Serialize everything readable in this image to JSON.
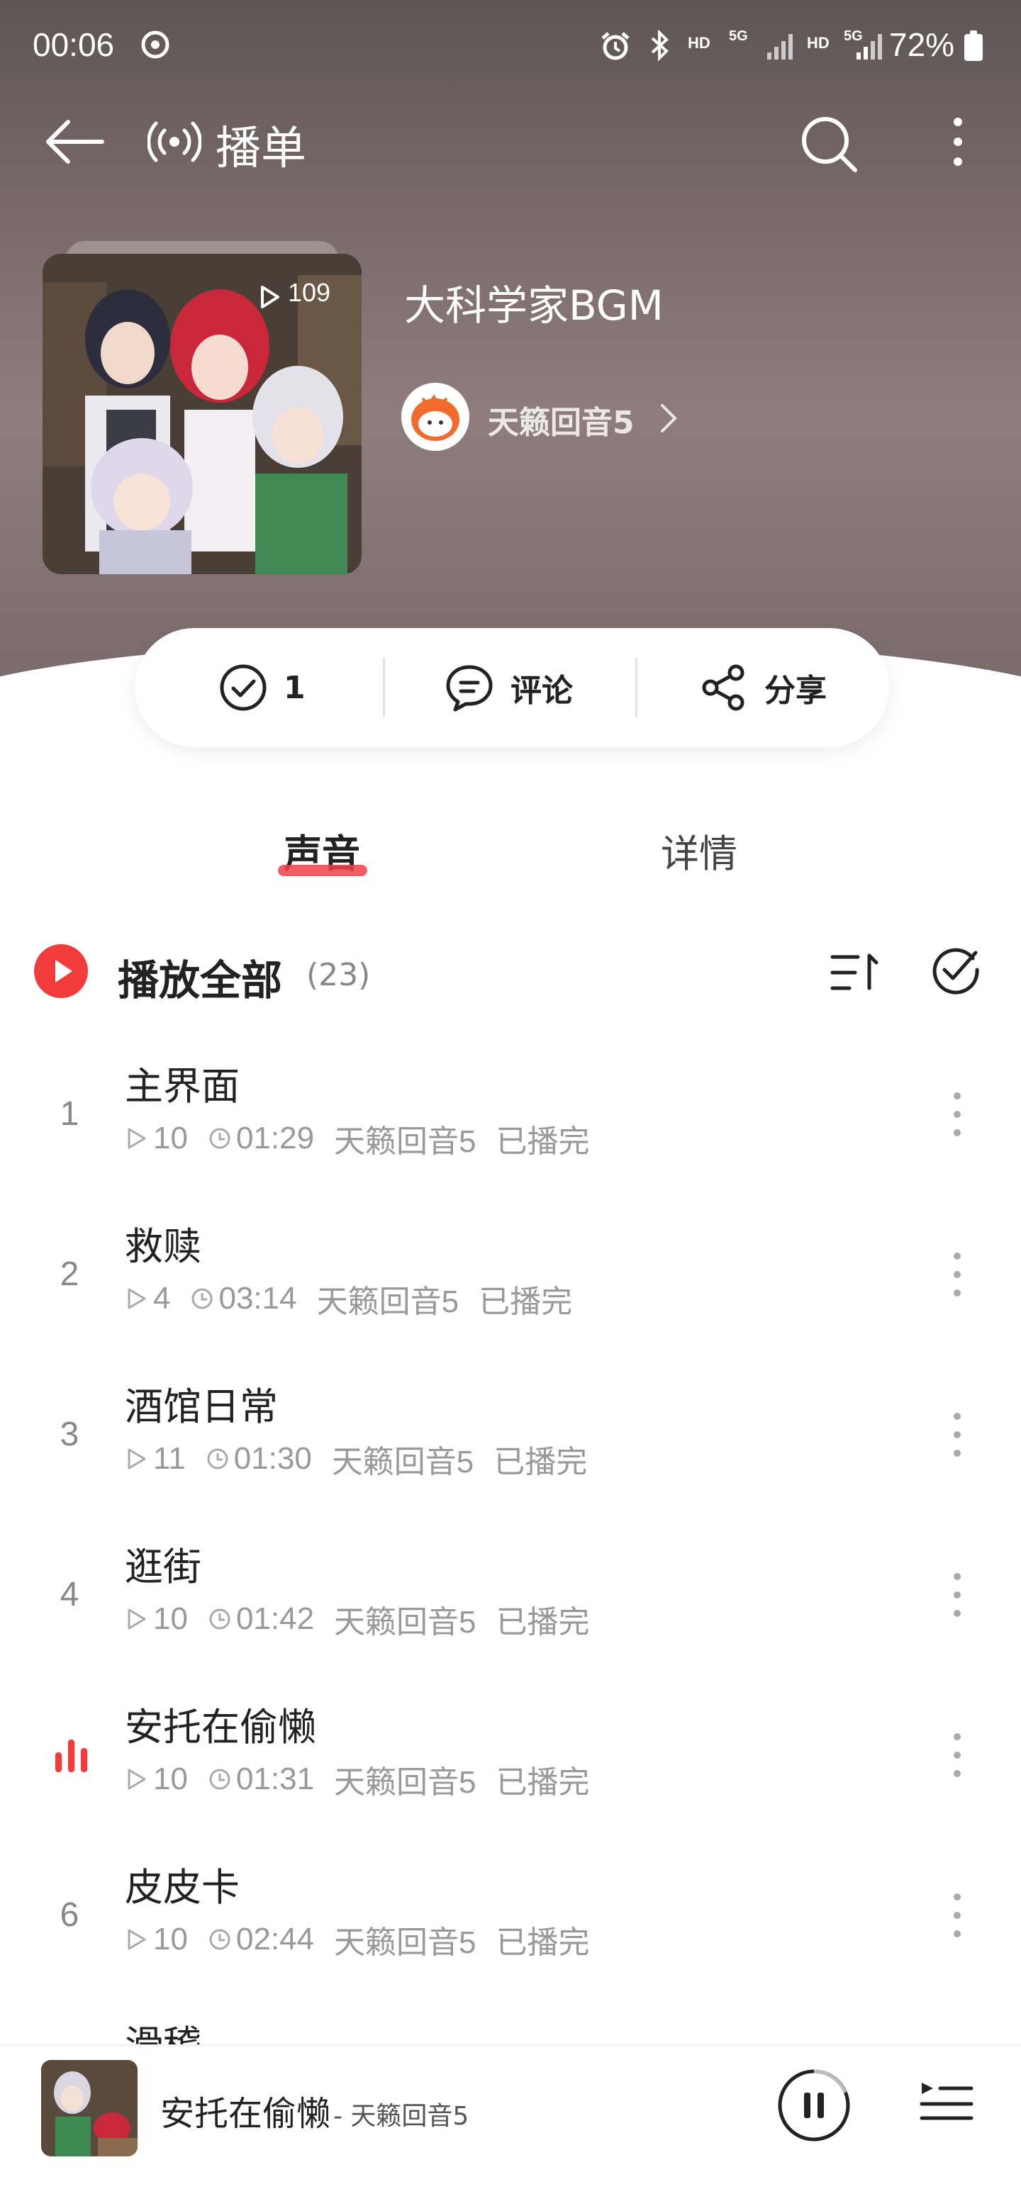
{
  "status_bar": {
    "time": "00:06",
    "hd_1": "HD",
    "net_1": "5G",
    "hd_2": "HD",
    "net_2": "5G",
    "battery": "72%",
    "icons": [
      "alarm-icon",
      "bluetooth-icon",
      "signal-icon",
      "battery-icon"
    ]
  },
  "nav": {
    "title": "播单",
    "icons": [
      "back-arrow-icon",
      "radio-icon",
      "search-icon",
      "more-vertical-icon"
    ]
  },
  "album": {
    "title": "大科学家BGM",
    "play_count": "109",
    "author": "天籁回音5"
  },
  "actions": {
    "subscribe_count": "1",
    "comment_label": "评论",
    "share_label": "分享"
  },
  "tabs": {
    "sound": "声音",
    "detail": "详情"
  },
  "play_all": {
    "label": "播放全部",
    "count": "(23)"
  },
  "tracks": [
    {
      "index": "1",
      "title": "主界面",
      "plays": "10",
      "duration": "01:29",
      "author": "天籁回音5",
      "status": "已播完",
      "playing": false
    },
    {
      "index": "2",
      "title": "救赎",
      "plays": "4",
      "duration": "03:14",
      "author": "天籁回音5",
      "status": "已播完",
      "playing": false
    },
    {
      "index": "3",
      "title": "酒馆日常",
      "plays": "11",
      "duration": "01:30",
      "author": "天籁回音5",
      "status": "已播完",
      "playing": false
    },
    {
      "index": "4",
      "title": "逛街",
      "plays": "10",
      "duration": "01:42",
      "author": "天籁回音5",
      "status": "已播完",
      "playing": false
    },
    {
      "index": "",
      "title": "安托在偷懒",
      "plays": "10",
      "duration": "01:31",
      "author": "天籁回音5",
      "status": "已播完",
      "playing": true
    },
    {
      "index": "6",
      "title": "皮皮卡",
      "plays": "10",
      "duration": "02:44",
      "author": "天籁回音5",
      "status": "已播完",
      "playing": false
    }
  ],
  "partial_track_title": "滑稽",
  "mini_player": {
    "title": "安托在偷懒",
    "subtitle": "- 天籁回音5"
  },
  "colors": {
    "accent": "#f23c3c",
    "text_primary": "#222222",
    "text_secondary": "#999999"
  }
}
